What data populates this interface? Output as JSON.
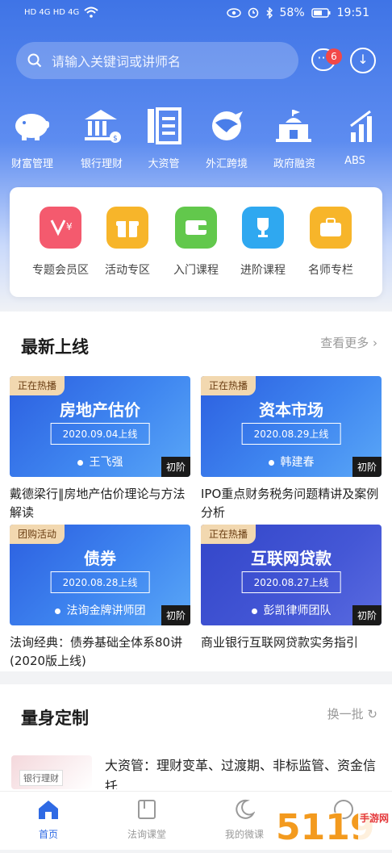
{
  "status_bar": {
    "left": "HD 4G HD 4G",
    "battery": "58%",
    "time": "19:51"
  },
  "search": {
    "placeholder": "请输入关键词或讲师名"
  },
  "header": {
    "message_badge": "6"
  },
  "categories": [
    {
      "label": "财富管理",
      "icon": "piggy-bank-icon"
    },
    {
      "label": "银行理财",
      "icon": "bank-icon"
    },
    {
      "label": "大资管",
      "icon": "document-icon"
    },
    {
      "label": "外汇跨境",
      "icon": "globe-plane-icon"
    },
    {
      "label": "政府融资",
      "icon": "government-building-icon"
    },
    {
      "label": "ABS",
      "icon": "chart-up-icon"
    }
  ],
  "quick_tiles": [
    {
      "label": "专题会员区",
      "color": "#f45a6e",
      "icon": "member-icon"
    },
    {
      "label": "活动专区",
      "color": "#f7b52a",
      "icon": "gift-icon"
    },
    {
      "label": "入门课程",
      "color": "#62c84c",
      "icon": "wallet-icon"
    },
    {
      "label": "进阶课程",
      "color": "#2fa8f0",
      "icon": "trophy-icon"
    },
    {
      "label": "名师专栏",
      "color": "#f7b52a",
      "icon": "briefcase-icon"
    }
  ],
  "latest": {
    "title": "最新上线",
    "more": "查看更多",
    "courses": [
      {
        "tag": "正在热播",
        "thumb_title": "房地产估价",
        "date": "2020.09.04上线",
        "lecturer": "王飞强",
        "level": "初阶",
        "title": "戴德梁行‖房地产估价理论与方法解读"
      },
      {
        "tag": "正在热播",
        "thumb_title": "资本市场",
        "date": "2020.08.29上线",
        "lecturer": "韩建春",
        "level": "初阶",
        "title": "IPO重点财务税务问题精讲及案例分析"
      },
      {
        "tag": "团购活动",
        "thumb_title": "债券",
        "date": "2020.08.28上线",
        "lecturer": "法询金牌讲师团",
        "level": "初阶",
        "title": "法询经典：债券基础全体系80讲 (2020版上线)"
      },
      {
        "tag": "正在热播",
        "thumb_title": "互联网贷款",
        "date": "2020.08.27上线",
        "lecturer": "彭凯律师团队",
        "level": "初阶",
        "title": "商业银行互联网贷款实务指引"
      }
    ]
  },
  "custom": {
    "title": "量身定制",
    "refresh": "换一批",
    "thumb_label": "银行理财",
    "item_title": "大资管：理财变革、过渡期、非标监管、资金信托"
  },
  "tabs": [
    {
      "label": "首页",
      "icon": "home-icon"
    },
    {
      "label": "法询课堂",
      "icon": "book-icon"
    },
    {
      "label": "我的微课",
      "icon": "moon-icon"
    },
    {
      "label": "",
      "icon": "profile-icon"
    }
  ],
  "watermark": "5119手游网"
}
